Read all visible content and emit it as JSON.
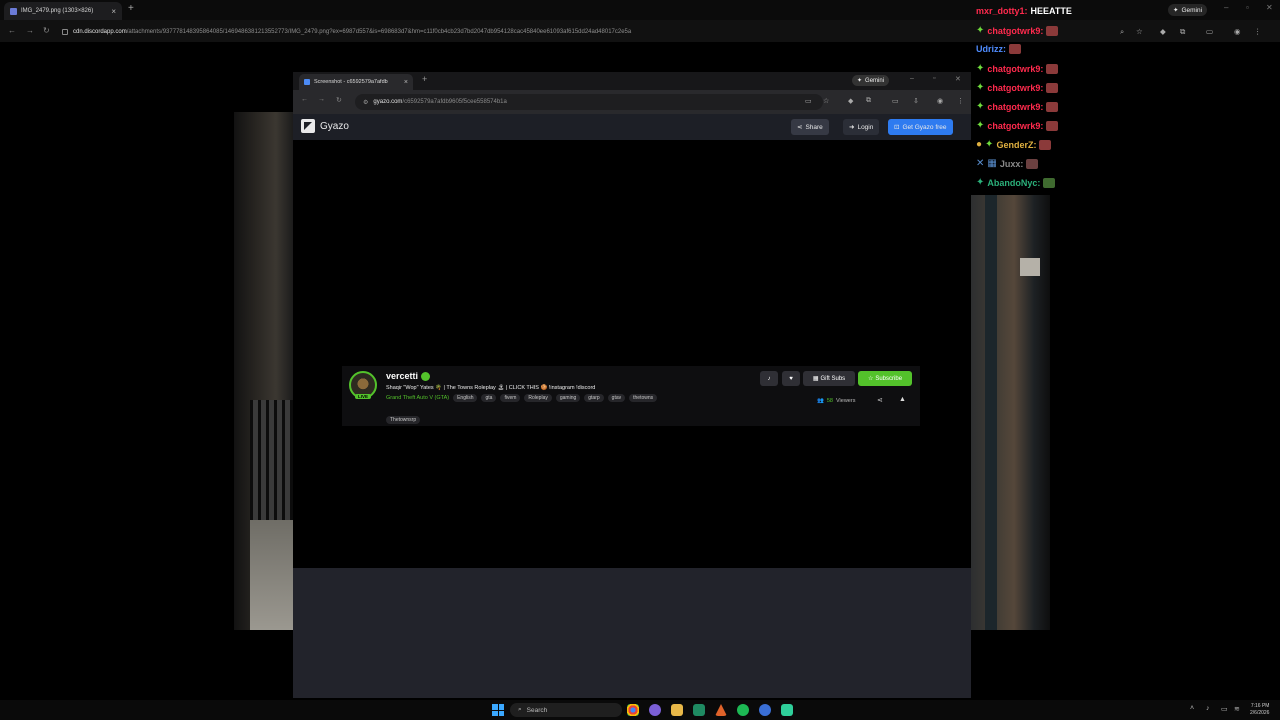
{
  "outer_browser": {
    "tab_title": "IMG_2479.png (1303×826)",
    "url_host": "cdn.discordapp.com",
    "url_path": "/attachments/937778148395864085/1469486381213552773/IMG_2479.png?ex=6987d557&is=698683d7&hm=c11f0cb4cb23d7bd2047db954128cac45840ee61093af615dd24ad48017c2e5a",
    "gemini_label": "Gemini"
  },
  "inner_browser": {
    "tab_title": "Screenshot - c6592579a7afdb",
    "url_host": "gyazo.com",
    "url_path": "/c6592579a7afdb9605f5cee558574b1a",
    "gemini_label": "Gemini"
  },
  "gyazo": {
    "logo_text": "Gyazo",
    "share_label": "Share",
    "login_label": "Login",
    "get_free_label": "Get Gyazo free"
  },
  "stream": {
    "live_badge": "LIVE",
    "streamer": "vercetti",
    "title": "Shaqir \"Wop\" Yates 🌴 | The Towns Roleplay 🏝 | CLICK THIS 🍪 !instagram !discord",
    "game": "Grand Theft Auto V (GTA)",
    "tags": [
      "English",
      "gta",
      "fivem",
      "Roleplay",
      "gaming",
      "gtarp",
      "gtav",
      "thetowns"
    ],
    "tag_row2": "Thetownsrp",
    "gift_subs_label": "Gift Subs",
    "subscribe_label": "Subscribe",
    "viewers_count": "58",
    "viewers_label": "Viewers"
  },
  "chat": [
    {
      "user": "mxr_dotty1:",
      "msg": "HEEATTE",
      "color": "#ff2a4d",
      "badge": false,
      "emote": false
    },
    {
      "user": "chatgotwrk9:",
      "msg": "",
      "color": "#ff2a4d",
      "badge": true,
      "emote": true
    },
    {
      "user": "Udrizz:",
      "msg": "",
      "color": "#4f8cff",
      "badge": false,
      "emote": true
    },
    {
      "user": "chatgotwrk9:",
      "msg": "",
      "color": "#ff2a4d",
      "badge": true,
      "emote": true
    },
    {
      "user": "chatgotwrk9:",
      "msg": "",
      "color": "#ff2a4d",
      "badge": true,
      "emote": true
    },
    {
      "user": "chatgotwrk9:",
      "msg": "",
      "color": "#ff2a4d",
      "badge": true,
      "emote": true
    },
    {
      "user": "chatgotwrk9:",
      "msg": "",
      "color": "#ff2a4d",
      "badge": true,
      "emote": true
    },
    {
      "user": "GenderZ:",
      "msg": "",
      "color": "#e0b040",
      "badge": true,
      "emote": true
    },
    {
      "user": "Juxx:",
      "msg": "",
      "color": "#8a8a8a",
      "badge": true,
      "emote": true
    },
    {
      "user": "AbandoNyc:",
      "msg": "",
      "color": "#2bb07a",
      "badge": true,
      "emote": true
    }
  ],
  "taskbar": {
    "search_label": "Search",
    "time": "7:16 PM",
    "date": "2/6/2026"
  },
  "colors": {
    "twitch_green": "#53c22b",
    "gyazo_blue": "#2e7bf0"
  }
}
